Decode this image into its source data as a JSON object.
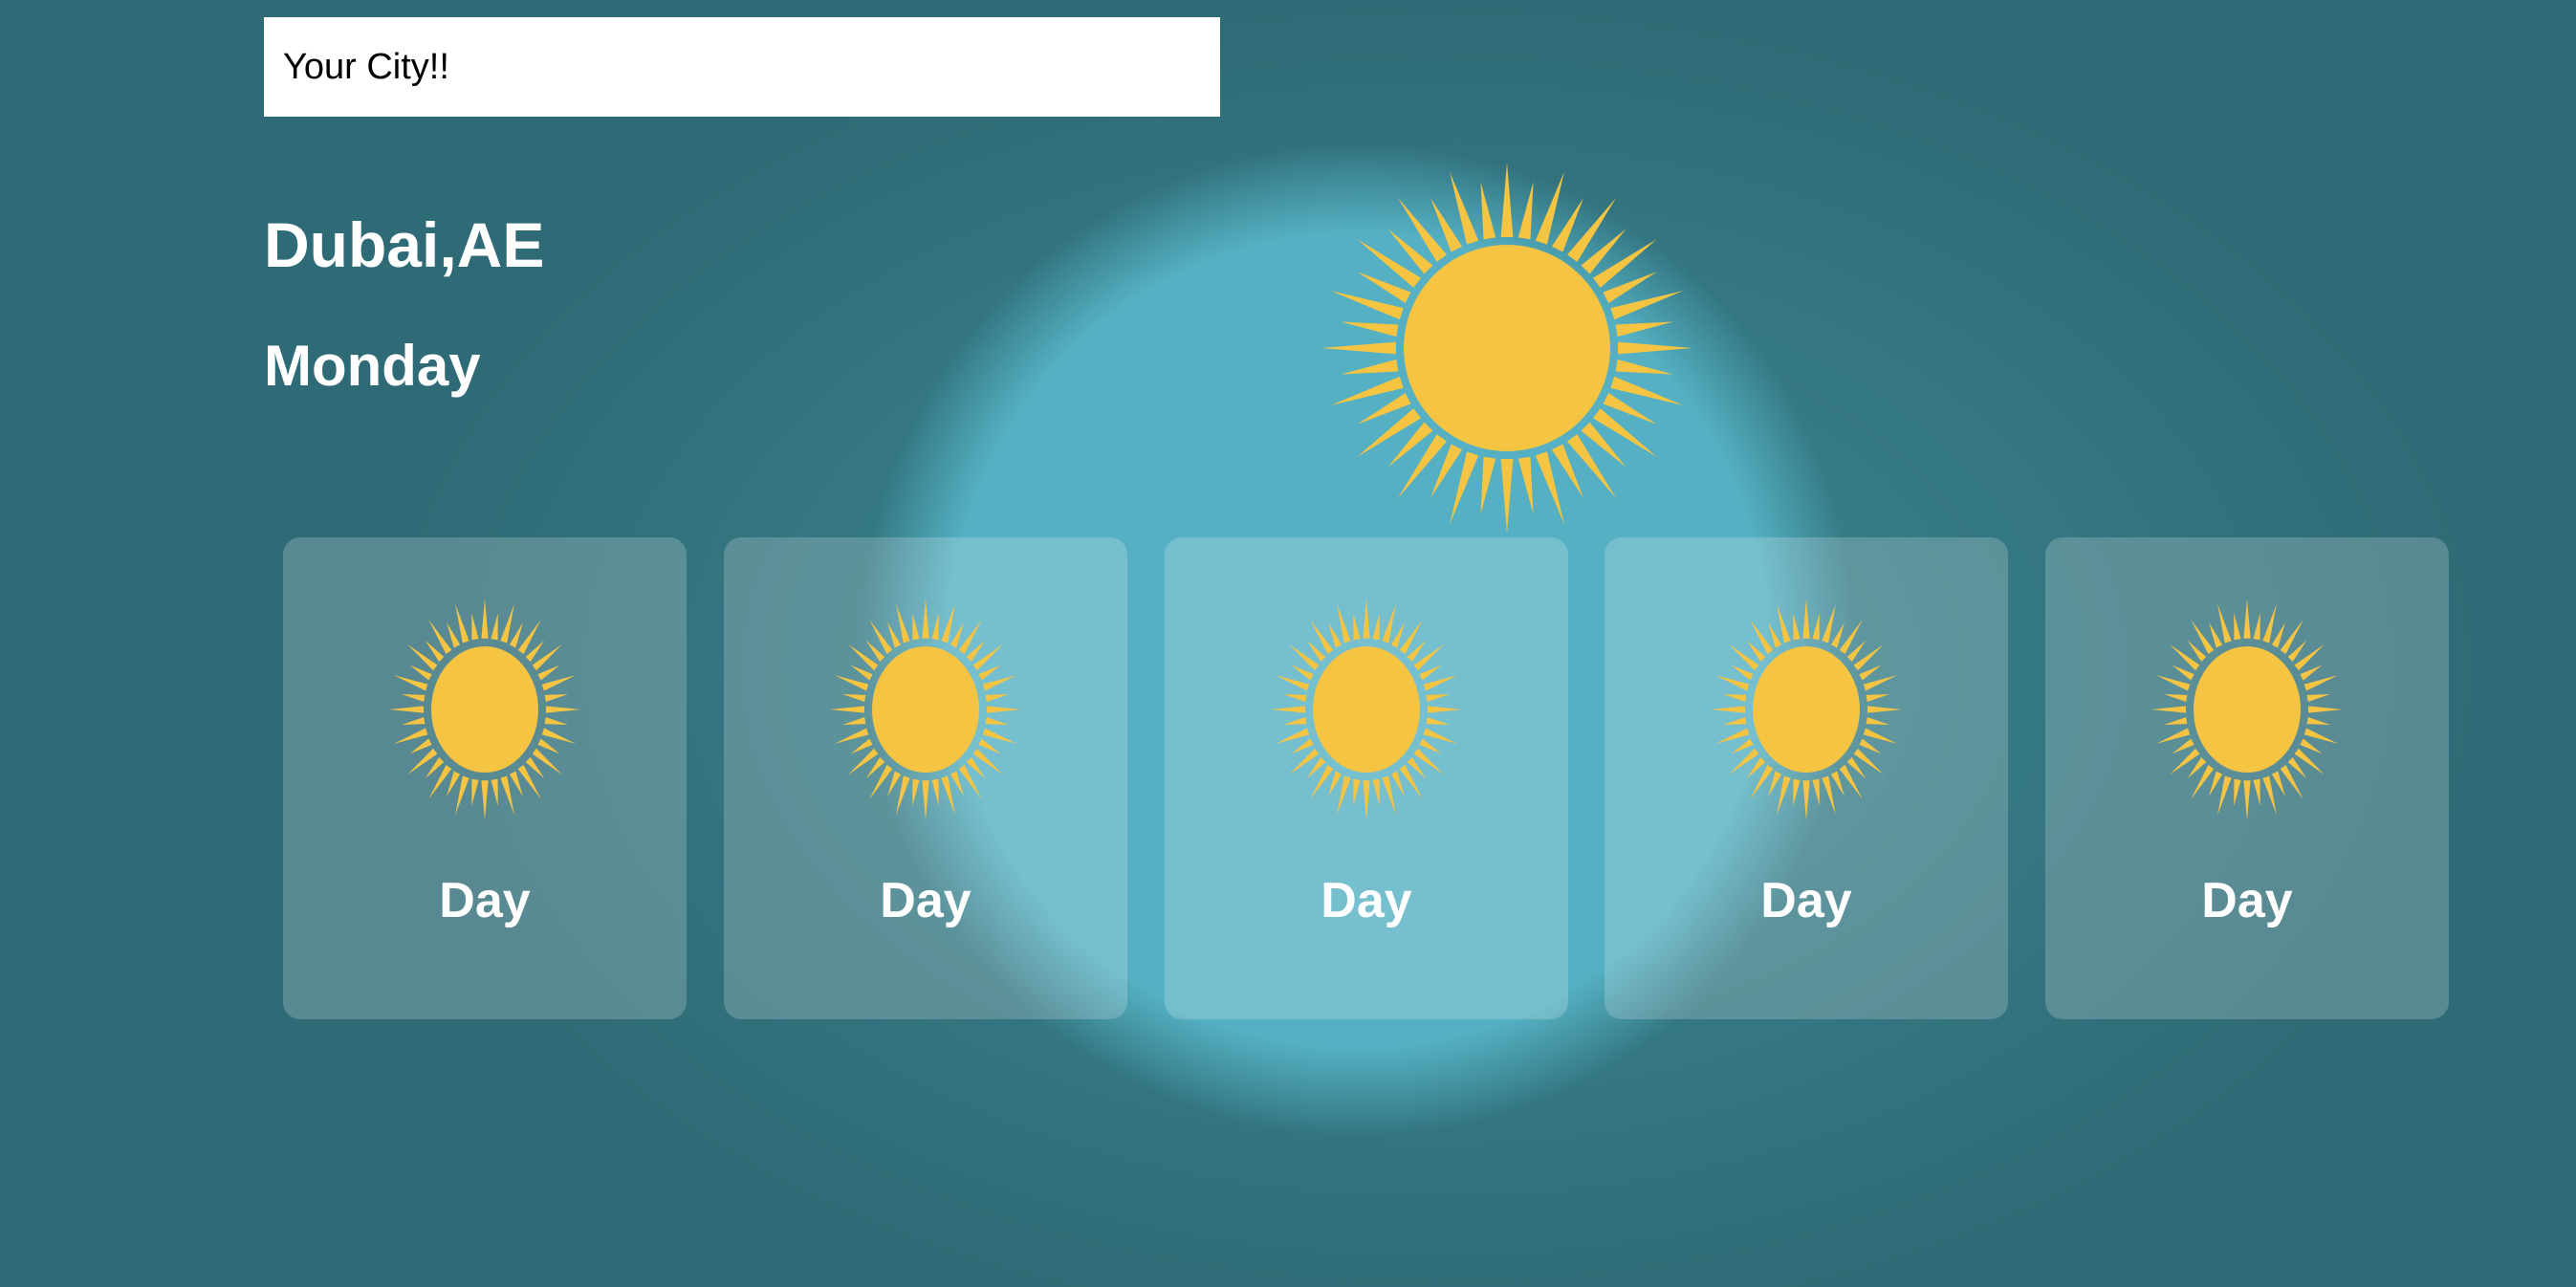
{
  "search": {
    "placeholder": "Your City!!"
  },
  "location": {
    "city": "Dubai,AE",
    "day": "Monday"
  },
  "current": {
    "icon": "sun-icon"
  },
  "forecast": [
    {
      "label": "Day",
      "icon": "sun-icon"
    },
    {
      "label": "Day",
      "icon": "sun-icon"
    },
    {
      "label": "Day",
      "icon": "sun-icon"
    },
    {
      "label": "Day",
      "icon": "sun-icon"
    },
    {
      "label": "Day",
      "icon": "sun-icon"
    }
  ],
  "colors": {
    "background": "#357580",
    "glow": "#54b0c2",
    "sun": "#f5c443",
    "text": "#ffffff"
  }
}
